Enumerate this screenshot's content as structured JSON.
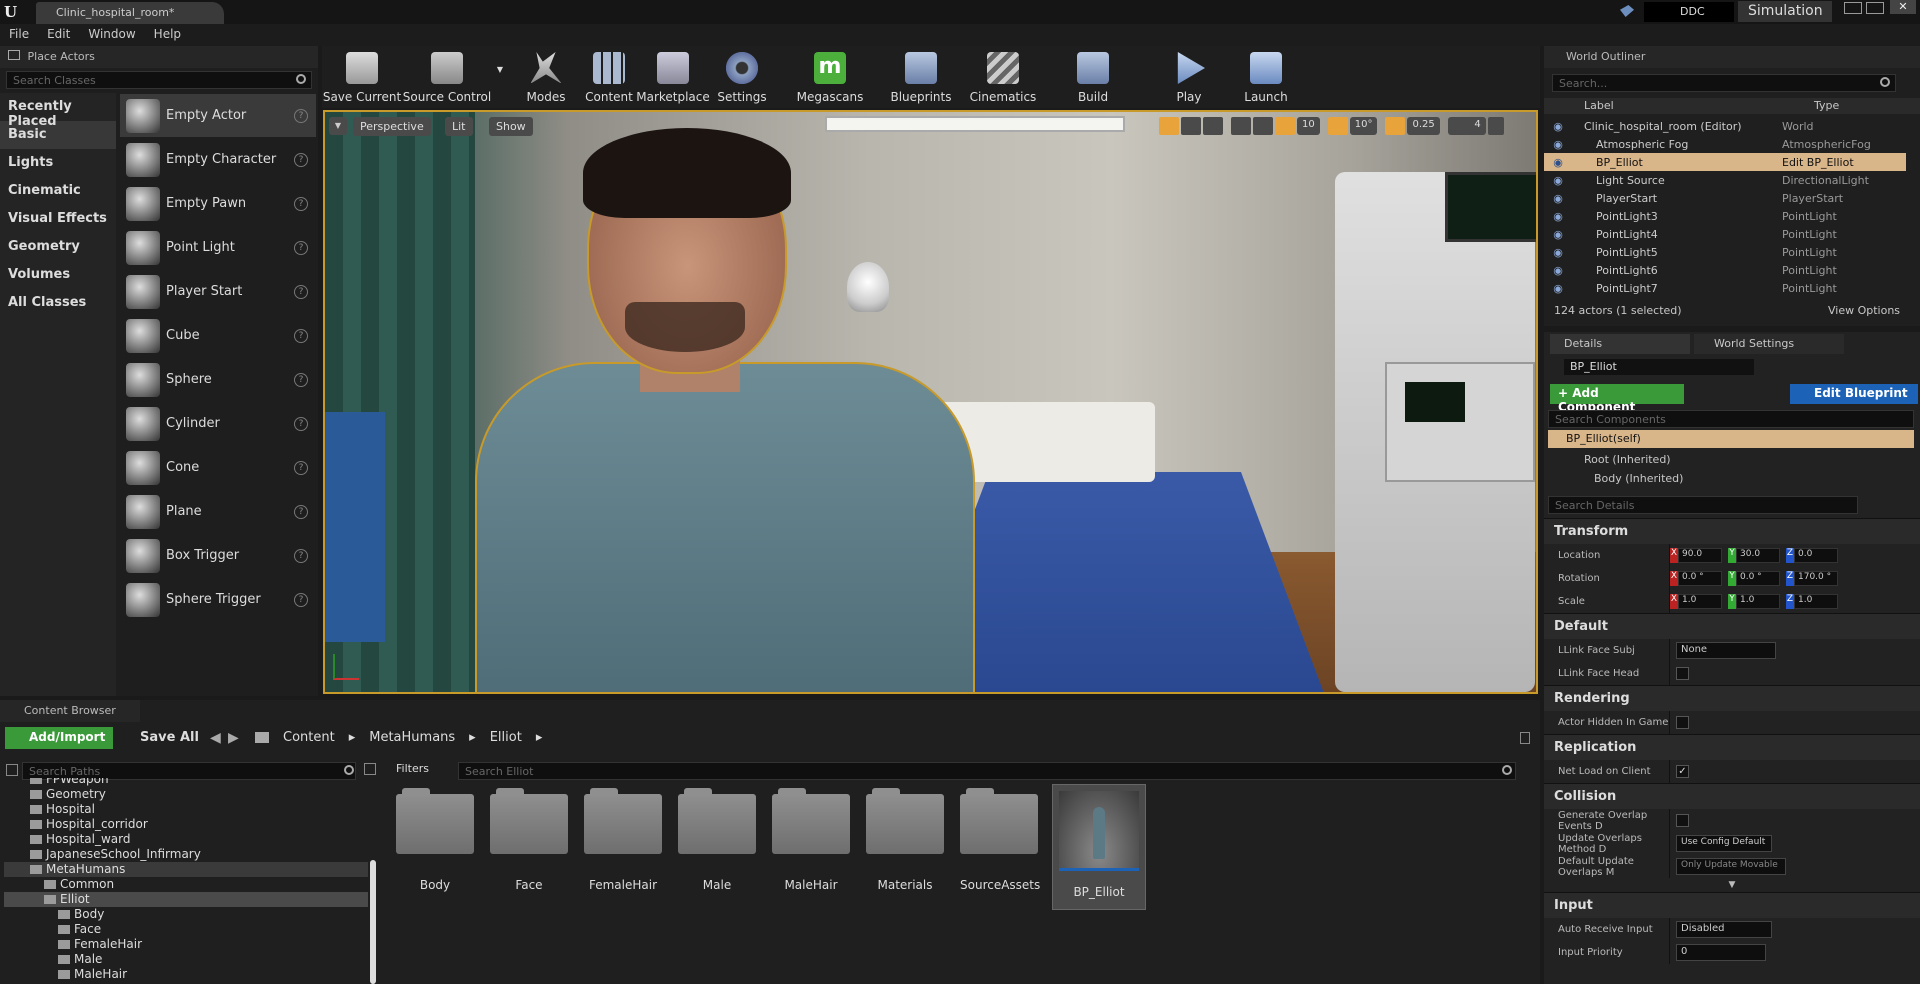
{
  "window": {
    "tab_title": "Clinic_hospital_room*",
    "ddc_label": "DDC",
    "simulation_label": "Simulation"
  },
  "menu": [
    "File",
    "Edit",
    "Window",
    "Help"
  ],
  "place_actors": {
    "title": "Place Actors",
    "search_placeholder": "Search Classes",
    "categories": [
      "Recently Placed",
      "Basic",
      "Lights",
      "Cinematic",
      "Visual Effects",
      "Geometry",
      "Volumes",
      "All Classes"
    ],
    "selected_category": "Basic",
    "items": [
      "Empty Actor",
      "Empty Character",
      "Empty Pawn",
      "Point Light",
      "Player Start",
      "Cube",
      "Sphere",
      "Cylinder",
      "Cone",
      "Plane",
      "Box Trigger",
      "Sphere Trigger"
    ]
  },
  "toolbar": [
    {
      "label": "Save Current",
      "icon": "save-icon"
    },
    {
      "label": "Source Control",
      "icon": "source-control-icon"
    },
    {
      "label": "Modes",
      "icon": "modes-icon"
    },
    {
      "label": "Content",
      "icon": "content-icon"
    },
    {
      "label": "Marketplace",
      "icon": "marketplace-icon"
    },
    {
      "label": "Settings",
      "icon": "settings-icon"
    },
    {
      "label": "Megascans",
      "icon": "megascans-icon"
    },
    {
      "label": "Blueprints",
      "icon": "blueprints-icon"
    },
    {
      "label": "Cinematics",
      "icon": "cinematics-icon"
    },
    {
      "label": "Build",
      "icon": "build-icon"
    },
    {
      "label": "Play",
      "icon": "play-icon"
    },
    {
      "label": "Launch",
      "icon": "launch-icon"
    }
  ],
  "megascans_glyph": "m",
  "viewport": {
    "perspective_label": "Perspective",
    "lit_label": "Lit",
    "show_label": "Show",
    "grid_snap": "10",
    "rot_snap": "10°",
    "scale_snap": "0.25",
    "camera_speed": "4"
  },
  "outliner": {
    "title": "World Outliner",
    "search_placeholder": "Search...",
    "col_label": "Label",
    "col_type": "Type",
    "rows": [
      {
        "label": "Clinic_hospital_room (Editor)",
        "type": "World"
      },
      {
        "label": "Atmospheric Fog",
        "type": "AtmosphericFog"
      },
      {
        "label": "BP_Elliot",
        "type": "Edit BP_Elliot"
      },
      {
        "label": "Light Source",
        "type": "DirectionalLight"
      },
      {
        "label": "PlayerStart",
        "type": "PlayerStart"
      },
      {
        "label": "PointLight3",
        "type": "PointLight"
      },
      {
        "label": "PointLight4",
        "type": "PointLight"
      },
      {
        "label": "PointLight5",
        "type": "PointLight"
      },
      {
        "label": "PointLight6",
        "type": "PointLight"
      },
      {
        "label": "PointLight7",
        "type": "PointLight"
      }
    ],
    "status": "124 actors (1 selected)",
    "view_options": "View Options"
  },
  "details": {
    "tab_details": "Details",
    "tab_world_settings": "World Settings",
    "actor_name": "BP_Elliot",
    "add_component": "+ Add Component",
    "edit_blueprint": "Edit Blueprint",
    "search_components": "Search Components",
    "components": [
      "BP_Elliot(self)",
      "Root (Inherited)",
      "Body (Inherited)"
    ],
    "search_details": "Search Details",
    "transform_title": "Transform",
    "location_label": "Location",
    "rotation_label": "Rotation",
    "scale_label": "Scale",
    "location": {
      "x": "90.0",
      "y": "30.0",
      "z": "0.0"
    },
    "rotation": {
      "x": "0.0 °",
      "y": "0.0 °",
      "z": "170.0 °"
    },
    "scale": {
      "x": "1.0",
      "y": "1.0",
      "z": "1.0"
    },
    "default_title": "Default",
    "llink_face_subj_label": "LLink Face Subj",
    "llink_face_subj_value": "None",
    "llink_face_head_label": "LLink Face Head",
    "rendering_title": "Rendering",
    "actor_hidden_label": "Actor Hidden In Game",
    "replication_title": "Replication",
    "net_load_label": "Net Load on Client",
    "collision_title": "Collision",
    "gen_overlap_label": "Generate Overlap Events D",
    "update_overlaps_label": "Update Overlaps Method D",
    "update_overlaps_value": "Use Config Default",
    "default_update_label": "Default Update Overlaps M",
    "default_update_value": "Only Update Movable",
    "input_title": "Input",
    "auto_receive_label": "Auto Receive Input",
    "auto_receive_value": "Disabled",
    "input_priority_label": "Input Priority",
    "input_priority_value": "0"
  },
  "content_browser": {
    "title": "Content Browser",
    "add_import": "Add/Import",
    "save_all": "Save All",
    "path": [
      "Content",
      "MetaHumans",
      "Elliot"
    ],
    "search_paths": "Search Paths",
    "filters": "Filters",
    "search_placeholder": "Search Elliot",
    "tree": [
      "FPWeapon",
      "Geometry",
      "Hospital",
      "Hospital_corridor",
      "Hospital_ward",
      "JapaneseSchool_Infirmary",
      "MetaHumans",
      "Common",
      "Elliot",
      "Body",
      "Face",
      "FemaleHair",
      "Male",
      "MaleHair"
    ],
    "assets": [
      "Body",
      "Face",
      "FemaleHair",
      "Male",
      "MaleHair",
      "Materials",
      "SourceAssets",
      "BP_Elliot"
    ]
  },
  "colors": {
    "accent_orange": "#e8a33a",
    "add_green": "#3a9a3a",
    "blueprint_blue": "#1c63b8",
    "selection": "#d9b58a"
  }
}
